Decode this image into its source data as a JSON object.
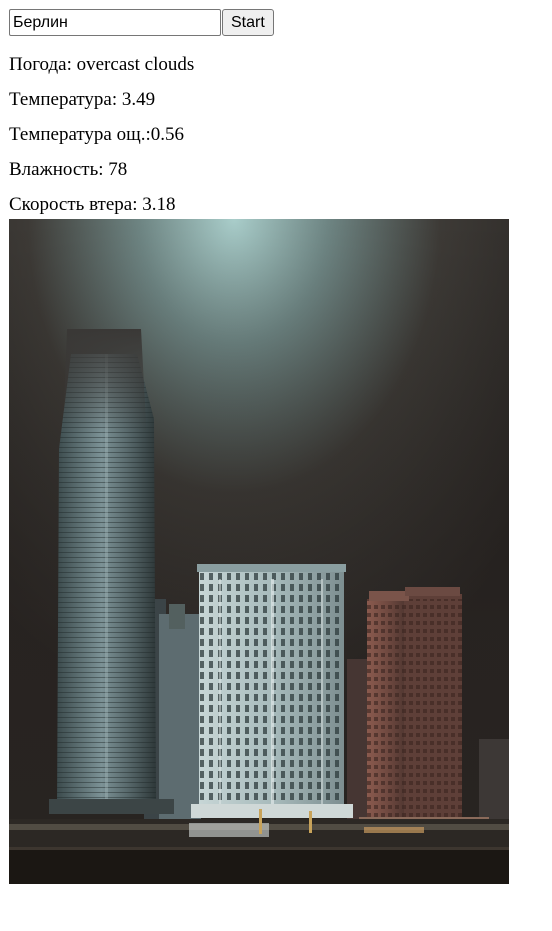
{
  "search": {
    "value": "Берлин",
    "button_label": "Start"
  },
  "weather": {
    "condition_label": "Погода: ",
    "condition_value": "overcast clouds",
    "temperature_label": "Температура: ",
    "temperature_value": "3.49",
    "feels_like_label": "Температура ощ.:",
    "feels_like_value": "0.56",
    "humidity_label": "Влажность: ",
    "humidity_value": "78",
    "wind_label": "Скорость втера: ",
    "wind_value": "3.18"
  },
  "photo": {
    "icon": "city-skyline-photo"
  }
}
